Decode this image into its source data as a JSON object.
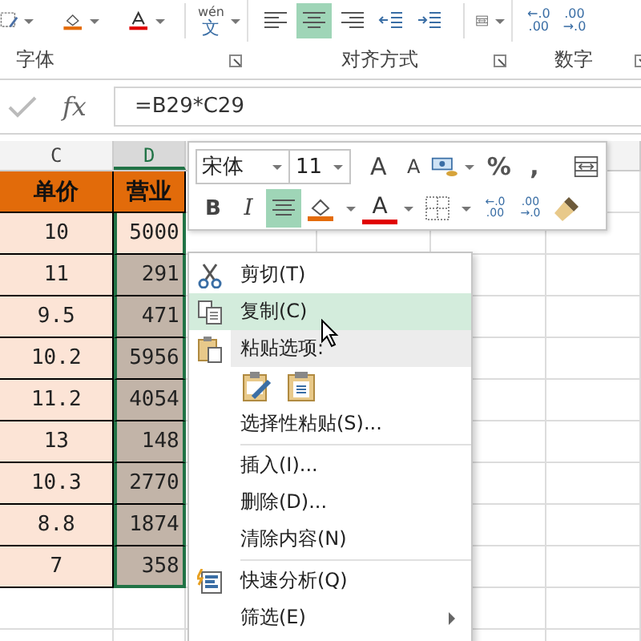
{
  "ribbon": {
    "phonetic": {
      "top": "wén",
      "bottom": "文"
    },
    "align_buttons": [
      {
        "kind": "left",
        "selected": false
      },
      {
        "kind": "center",
        "selected": true
      },
      {
        "kind": "right",
        "selected": false
      },
      {
        "kind": "outdent",
        "selected": false
      },
      {
        "kind": "indent",
        "selected": false
      }
    ],
    "decimal_buttons": [
      {
        "top": "←.0",
        "bottom": ".00"
      },
      {
        "top": ".00",
        "bottom": "→.0"
      }
    ],
    "groups": [
      {
        "label": "字体"
      },
      {
        "label": "对齐方式"
      },
      {
        "label": "数字"
      }
    ]
  },
  "formula_bar": {
    "function_label": "fx",
    "formula": "=B29*C29"
  },
  "columns": [
    {
      "label": "C",
      "selected": false
    },
    {
      "label": "D",
      "selected": true
    }
  ],
  "header_row": [
    "单价",
    "营业"
  ],
  "rows": [
    {
      "price": "10",
      "sales": "5000",
      "selected": false
    },
    {
      "price": "11",
      "sales": "291",
      "selected": true
    },
    {
      "price": "9.5",
      "sales": "471",
      "selected": true
    },
    {
      "price": "10.2",
      "sales": "5956",
      "selected": true
    },
    {
      "price": "11.2",
      "sales": "4054",
      "selected": true
    },
    {
      "price": "13",
      "sales": "148",
      "selected": true
    },
    {
      "price": "10.3",
      "sales": "2770",
      "selected": true
    },
    {
      "price": "8.8",
      "sales": "1874",
      "selected": true
    },
    {
      "price": "7",
      "sales": "358",
      "selected": true
    }
  ],
  "mini_toolbar": {
    "font": "宋体",
    "size": "11",
    "row1": [
      {
        "kind": "grow",
        "label": "A"
      },
      {
        "kind": "shrink",
        "label": "A"
      },
      {
        "kind": "currency"
      },
      {
        "kind": "text",
        "label": "%"
      },
      {
        "kind": "text",
        "label": ","
      },
      {
        "kind": "merge"
      }
    ],
    "row2": [
      {
        "kind": "bold",
        "label": "B",
        "selected": false
      },
      {
        "kind": "italic",
        "label": "I",
        "selected": false
      },
      {
        "kind": "align",
        "selected": true
      },
      {
        "kind": "fill",
        "selected": false
      },
      {
        "kind": "fontcolor",
        "label": "A",
        "selected": false
      },
      {
        "kind": "border",
        "selected": false
      },
      {
        "kind": "incdec",
        "top": "←.0",
        "bottom": ".00",
        "selected": false
      },
      {
        "kind": "decdec",
        "top": ".00",
        "bottom": "→.0",
        "selected": false
      },
      {
        "kind": "painter",
        "selected": false
      }
    ]
  },
  "context_menu": [
    {
      "kind": "cut",
      "label": "剪切(T)",
      "selected": false
    },
    {
      "kind": "copy",
      "label": "复制(C)",
      "selected": true
    },
    {
      "kind": "paste_header",
      "label": "粘贴选项:"
    },
    {
      "kind": "paste_icons"
    },
    {
      "kind": "plain",
      "label": "选择性粘贴(S)...",
      "selected": false
    },
    {
      "kind": "separator"
    },
    {
      "kind": "plain",
      "label": "插入(I)...",
      "selected": false
    },
    {
      "kind": "plain",
      "label": "删除(D)...",
      "selected": false
    },
    {
      "kind": "plain",
      "label": "清除内容(N)",
      "selected": false
    },
    {
      "kind": "separator"
    },
    {
      "kind": "analysis",
      "label": "快速分析(Q)",
      "selected": false
    },
    {
      "kind": "submenu",
      "label": "筛选(E)",
      "selected": false
    }
  ]
}
